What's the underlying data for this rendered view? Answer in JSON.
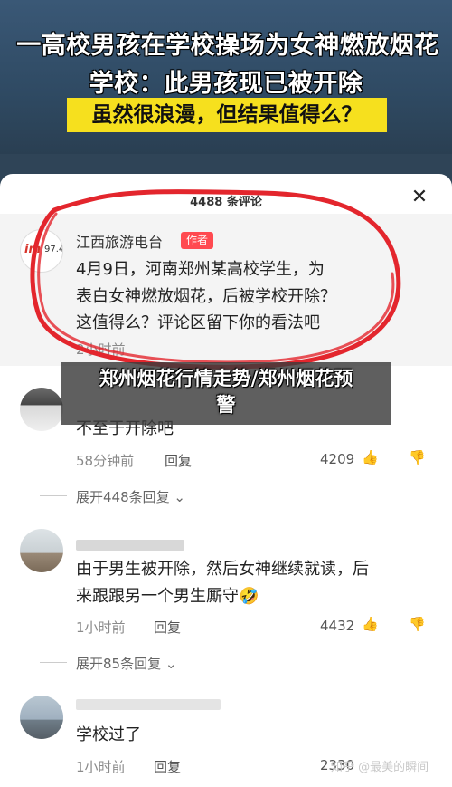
{
  "banner": {
    "headline_line1": "一高校男孩在学校操场为女神燃放烟花",
    "headline_line2": "学校：此男孩现已被开除",
    "highlight": "虽然很浪漫，但结果值得么？"
  },
  "sheet": {
    "title": "4488 条评论",
    "close_icon": "✕"
  },
  "pinned": {
    "username": "江西旅游电台",
    "badge": "作者",
    "avatar_logo": "im",
    "avatar_logo_freq": "97.4",
    "text_lines": [
      "4月9日，河南郑州某高校学生，为",
      "表白女神燃放烟花，后被学校开除？",
      "这值得么？评论区留下你的看法吧"
    ],
    "time": "2小时前"
  },
  "overlay": {
    "line1": "郑州烟花行情走势/郑州烟花预",
    "line2": "警"
  },
  "comments": [
    {
      "text": "不至于开除吧",
      "time": "58分钟前",
      "reply": "回复",
      "likes": "4209",
      "expand": "展开448条回复"
    },
    {
      "text_lines": [
        "由于男生被开除，然后女神继续就读，后",
        "来跟跟另一个男生厮守🤣"
      ],
      "time": "1小时前",
      "reply": "回复",
      "likes": "4432",
      "expand": "展开85条回复"
    },
    {
      "text": "学校过了",
      "time": "1小时前",
      "reply": "回复",
      "likes": "2330"
    }
  ],
  "watermark": "知乎 @最美的瞬间",
  "colors": {
    "ring": "#e3262d",
    "badge": "#ff4a50",
    "highlight": "#f6e01e"
  }
}
